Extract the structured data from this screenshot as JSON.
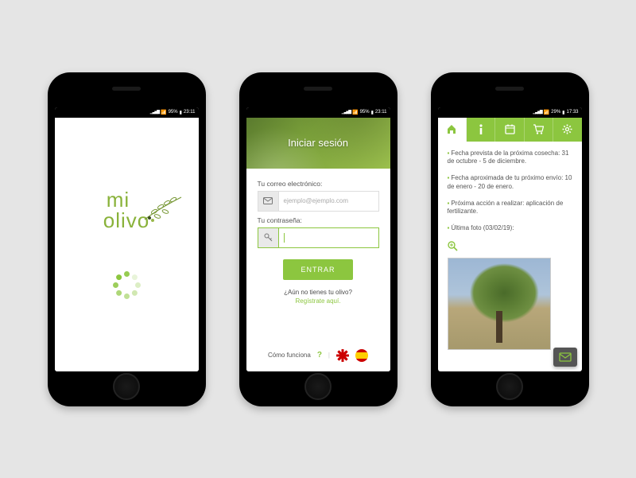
{
  "status": {
    "battery": "95%",
    "time_a": "23:11",
    "time_b": "17:33"
  },
  "brand": {
    "mi": "mi",
    "olivo": "olivo"
  },
  "login": {
    "title": "Iniciar sesión",
    "email_label": "Tu correo electrónico:",
    "email_placeholder": "ejemplo@ejemplo.com",
    "password_label": "Tu contraseña:",
    "submit": "ENTRAR",
    "signup_q": "¿Aún no tienes tu olivo?",
    "signup_link": "Regístrate aquí.",
    "how": "Cómo funciona"
  },
  "dash": {
    "items": [
      "Fecha prevista de la próxima cosecha: 31 de octubre - 5 de diciembre.",
      "Fecha aproximada de tu próximo envío: 10 de enero - 20 de enero.",
      "Próxima acción a realizar: aplicación de fertilizante.",
      "Última foto (03/02/19):"
    ]
  }
}
